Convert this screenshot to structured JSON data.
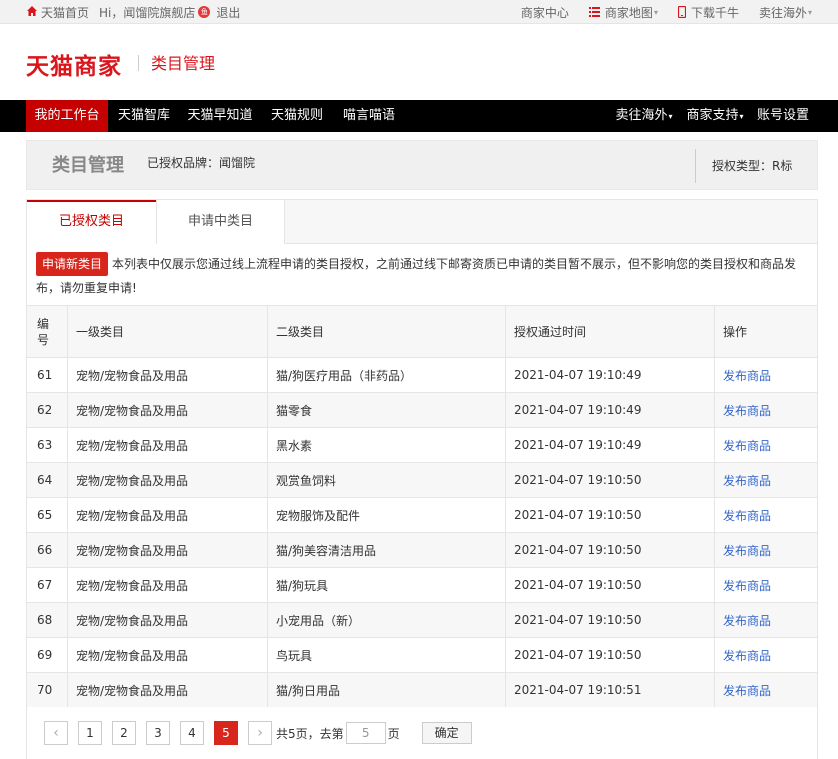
{
  "topbar": {
    "home": "天猫首页",
    "greeting": "Hi，闻馏院旗舰店",
    "badge": "鱼",
    "logout": "退出",
    "merchant_center": "商家中心",
    "merchant_map": "商家地图",
    "download": "下载千牛",
    "sell_overseas": "卖往海外"
  },
  "header": {
    "logo": "天猫商家",
    "subtitle": "类目管理"
  },
  "nav": {
    "items": [
      "我的工作台",
      "天猫智库",
      "天猫早知道",
      "天猫规则",
      "喵言喵语"
    ],
    "right_items": [
      "卖往海外",
      "商家支持",
      "账号设置"
    ]
  },
  "titlebar": {
    "title": "类目管理",
    "brand": "已授权品牌：闻馏院",
    "auth_type": "授权类型：R标"
  },
  "tabs": {
    "active": "已授权类目",
    "inactive": "申请中类目"
  },
  "notice": {
    "button": "申请新类目",
    "text": "本列表中仅展示您通过线上流程申请的类目授权，之前通过线下邮寄资质已申请的类目暂不展示，但不影响您的类目授权和商品发布，请勿重复申请!"
  },
  "table": {
    "headers": [
      "编号",
      "一级类目",
      "二级类目",
      "授权通过时间",
      "操作"
    ],
    "header_id_line1": "编",
    "header_id_line2": "号",
    "rows": [
      {
        "id": "61",
        "cat1": "宠物/宠物食品及用品",
        "cat2": "猫/狗医疗用品（非药品）",
        "time": "2021-04-07 19:10:49",
        "op": "发布商品"
      },
      {
        "id": "62",
        "cat1": "宠物/宠物食品及用品",
        "cat2": "猫零食",
        "time": "2021-04-07 19:10:49",
        "op": "发布商品"
      },
      {
        "id": "63",
        "cat1": "宠物/宠物食品及用品",
        "cat2": "黑水素",
        "time": "2021-04-07 19:10:49",
        "op": "发布商品"
      },
      {
        "id": "64",
        "cat1": "宠物/宠物食品及用品",
        "cat2": "观赏鱼饲料",
        "time": "2021-04-07 19:10:50",
        "op": "发布商品"
      },
      {
        "id": "65",
        "cat1": "宠物/宠物食品及用品",
        "cat2": "宠物服饰及配件",
        "time": "2021-04-07 19:10:50",
        "op": "发布商品"
      },
      {
        "id": "66",
        "cat1": "宠物/宠物食品及用品",
        "cat2": "猫/狗美容清洁用品",
        "time": "2021-04-07 19:10:50",
        "op": "发布商品"
      },
      {
        "id": "67",
        "cat1": "宠物/宠物食品及用品",
        "cat2": "猫/狗玩具",
        "time": "2021-04-07 19:10:50",
        "op": "发布商品"
      },
      {
        "id": "68",
        "cat1": "宠物/宠物食品及用品",
        "cat2": "小宠用品（新）",
        "time": "2021-04-07 19:10:50",
        "op": "发布商品"
      },
      {
        "id": "69",
        "cat1": "宠物/宠物食品及用品",
        "cat2": "鸟玩具",
        "time": "2021-04-07 19:10:50",
        "op": "发布商品"
      },
      {
        "id": "70",
        "cat1": "宠物/宠物食品及用品",
        "cat2": "猫/狗日用品",
        "time": "2021-04-07 19:10:51",
        "op": "发布商品"
      }
    ]
  },
  "pagination": {
    "prev": "‹",
    "next": "›",
    "pages": [
      "1",
      "2",
      "3",
      "4",
      "5"
    ],
    "current": "5",
    "total_text": "共5页，去第",
    "page_suffix": "页",
    "input_value": "5",
    "go": "确定"
  },
  "colors": {
    "brand_red": "#d9161c",
    "nav_bg": "#000000",
    "nav_active": "#c40000",
    "link_blue": "#3366cc"
  }
}
